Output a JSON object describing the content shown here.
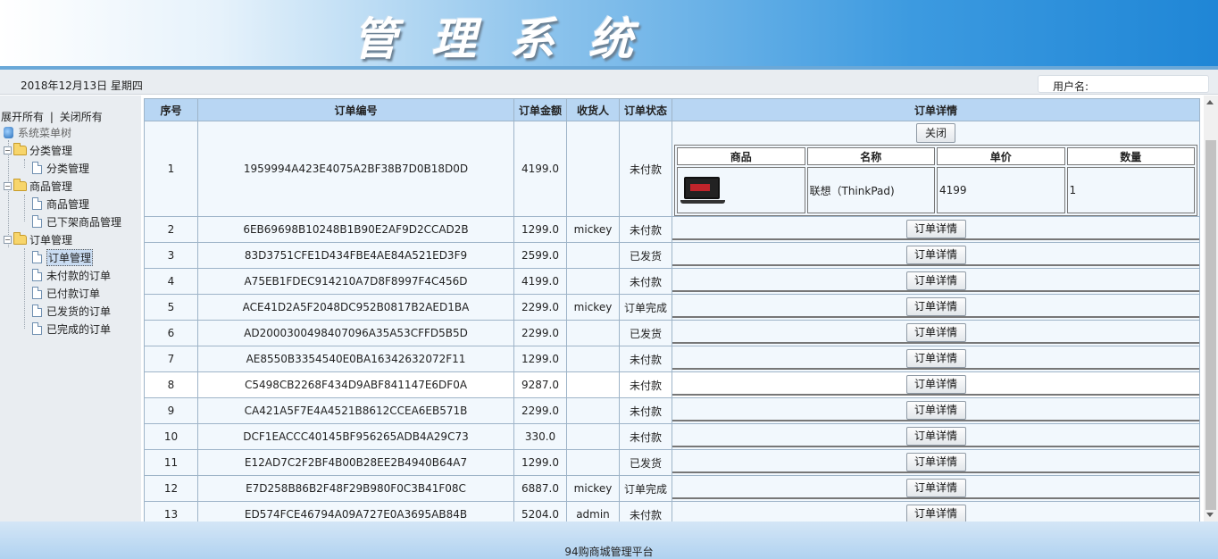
{
  "header": {
    "title": "管理系统"
  },
  "info_bar": {
    "date": "2018年12月13日 星期四",
    "user_label": "用户名:"
  },
  "sidebar": {
    "expand_all": "展开所有",
    "separator": "|",
    "collapse_all": "关闭所有",
    "root": "系统菜单树",
    "groups": [
      {
        "label": "分类管理",
        "items": [
          "分类管理"
        ]
      },
      {
        "label": "商品管理",
        "items": [
          "商品管理",
          "已下架商品管理"
        ]
      },
      {
        "label": "订单管理",
        "items": [
          "订单管理",
          "未付款的订单",
          "已付款订单",
          "已发货的订单",
          "已完成的订单"
        ]
      }
    ],
    "selected": "订单管理"
  },
  "table": {
    "headers": [
      "序号",
      "订单编号",
      "订单金额",
      "收货人",
      "订单状态",
      "订单详情"
    ],
    "detail_button": "订单详情",
    "close_button": "关闭",
    "expanded_detail": {
      "headers": [
        "商品",
        "名称",
        "单价",
        "数量"
      ],
      "item": {
        "image": "laptop-thumbnail",
        "name": "联想（ThinkPad)",
        "price": "4199",
        "qty": "1"
      }
    },
    "rows": [
      {
        "no": "1",
        "id": "1959994A423E4075A2BF38B7D0B18D0D",
        "amount": "4199.0",
        "receiver": "",
        "status": "未付款"
      },
      {
        "no": "2",
        "id": "6EB69698B10248B1B90E2AF9D2CCAD2B",
        "amount": "1299.0",
        "receiver": "mickey",
        "status": "未付款"
      },
      {
        "no": "3",
        "id": "83D3751CFE1D434FBE4AE84A521ED3F9",
        "amount": "2599.0",
        "receiver": "",
        "status": "已发货"
      },
      {
        "no": "4",
        "id": "A75EB1FDEC914210A7D8F8997F4C456D",
        "amount": "4199.0",
        "receiver": "",
        "status": "未付款"
      },
      {
        "no": "5",
        "id": "ACE41D2A5F2048DC952B0817B2AED1BA",
        "amount": "2299.0",
        "receiver": "mickey",
        "status": "订单完成"
      },
      {
        "no": "6",
        "id": "AD2000300498407096A35A53CFFD5B5D",
        "amount": "2299.0",
        "receiver": "",
        "status": "已发货"
      },
      {
        "no": "7",
        "id": "AE8550B3354540E0BA16342632072F11",
        "amount": "1299.0",
        "receiver": "",
        "status": "未付款"
      },
      {
        "no": "8",
        "id": "C5498CB2268F434D9ABF841147E6DF0A",
        "amount": "9287.0",
        "receiver": "",
        "status": "未付款"
      },
      {
        "no": "9",
        "id": "CA421A5F7E4A4521B8612CCEA6EB571B",
        "amount": "2299.0",
        "receiver": "",
        "status": "未付款"
      },
      {
        "no": "10",
        "id": "DCF1EACCC40145BF956265ADB4A29C73",
        "amount": "330.0",
        "receiver": "",
        "status": "未付款"
      },
      {
        "no": "11",
        "id": "E12AD7C2F2BF4B00B28EE2B4940B64A7",
        "amount": "1299.0",
        "receiver": "",
        "status": "已发货"
      },
      {
        "no": "12",
        "id": "E7D258B86B2F48F29B980F0C3B41F08C",
        "amount": "6887.0",
        "receiver": "mickey",
        "status": "订单完成"
      },
      {
        "no": "13",
        "id": "ED574FCE46794A09A727E0A3695AB84B",
        "amount": "5204.0",
        "receiver": "admin",
        "status": "未付款"
      }
    ]
  },
  "footer": {
    "text": "94购商城管理平台"
  }
}
